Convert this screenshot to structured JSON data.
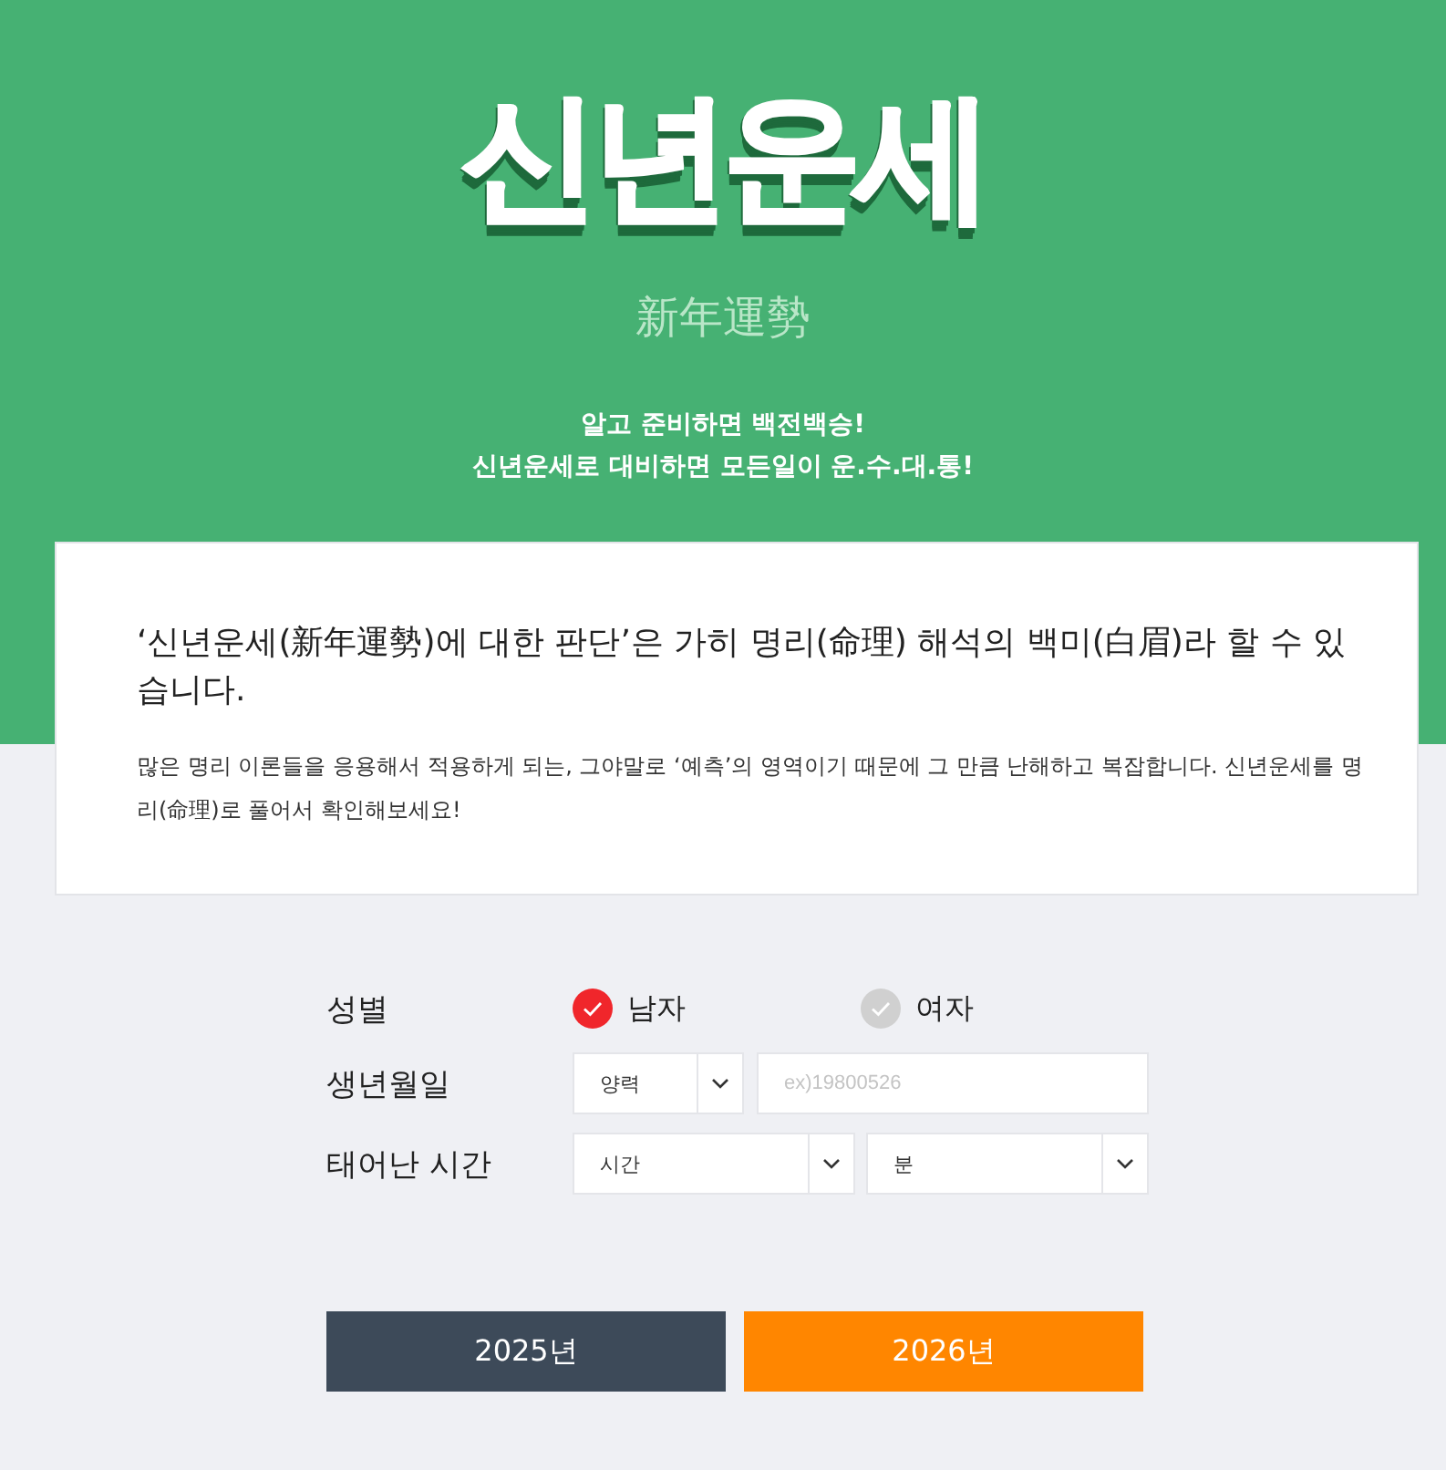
{
  "header": {
    "title": "신년운세",
    "subtitle": "新年運勢",
    "tagline": [
      "알고 준비하면 백전백승!",
      "신년운세로 대비하면 모든일이 운.수.대.통!"
    ]
  },
  "intro": {
    "heading": "‘신년운세(新年運勢)에 대한 판단’은 가히 명리(命理) 해석의 백미(白眉)라 할 수 있습니다.",
    "body": "많은 명리 이론들을 응용해서 적용하게 되는, 그야말로 ‘예측’의 영역이기 때문에 그 만큼 난해하고 복잡합니다. 신년운세를 명리(命理)로 풀어서 확인해보세요!"
  },
  "form": {
    "gender": {
      "label": "성별",
      "options": [
        {
          "label": "남자",
          "selected": true
        },
        {
          "label": "여자",
          "selected": false
        }
      ]
    },
    "birth": {
      "label": "생년월일",
      "calendar": "양력",
      "date": {
        "placeholder": "ex)19800526"
      }
    },
    "time": {
      "label": "태어난 시간",
      "hour": "시간",
      "minute": "분"
    }
  },
  "buttons": [
    {
      "label": "2025년",
      "color": "#3d4a59"
    },
    {
      "label": "2026년",
      "color": "#ff8600"
    }
  ]
}
